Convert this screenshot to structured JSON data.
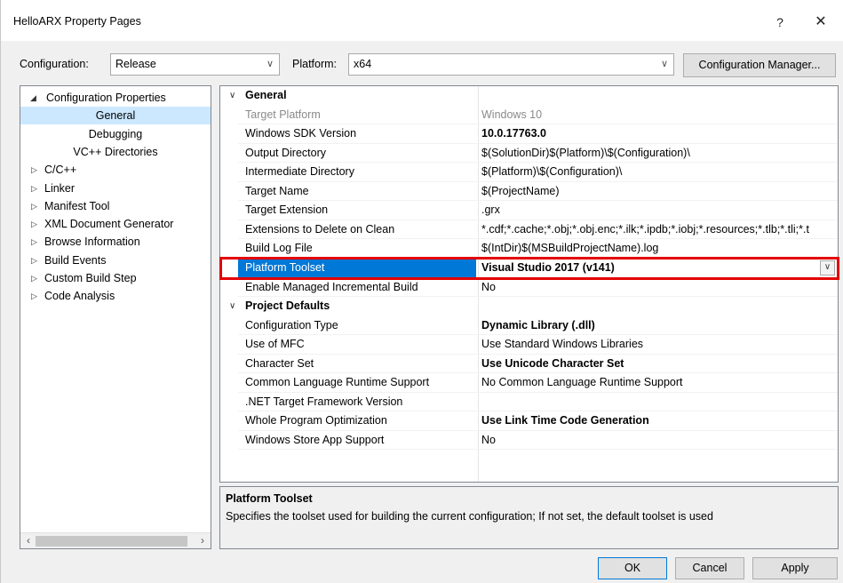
{
  "window": {
    "title": "HelloARX Property Pages",
    "help_glyph": "?",
    "close_glyph": "✕"
  },
  "toolbar": {
    "configuration_label": "Configuration:",
    "configuration_value": "Release",
    "platform_label": "Platform:",
    "platform_value": "x64",
    "config_manager_label": "Configuration Manager..."
  },
  "tree": {
    "items": [
      {
        "label": "Configuration Properties",
        "arrow": "◢",
        "level": 0
      },
      {
        "label": "General",
        "level": 1,
        "selected": true
      },
      {
        "label": "Debugging",
        "level": 1
      },
      {
        "label": "VC++ Directories",
        "level": 1
      },
      {
        "label": "C/C++",
        "arrow": "▷",
        "level": 0
      },
      {
        "label": "Linker",
        "arrow": "▷",
        "level": 0
      },
      {
        "label": "Manifest Tool",
        "arrow": "▷",
        "level": 0
      },
      {
        "label": "XML Document Generator",
        "arrow": "▷",
        "level": 0
      },
      {
        "label": "Browse Information",
        "arrow": "▷",
        "level": 0
      },
      {
        "label": "Build Events",
        "arrow": "▷",
        "level": 0
      },
      {
        "label": "Custom Build Step",
        "arrow": "▷",
        "level": 0
      },
      {
        "label": "Code Analysis",
        "arrow": "▷",
        "level": 0
      }
    ]
  },
  "grid": {
    "rows": [
      {
        "type": "cat",
        "name": "General",
        "chev": "∨"
      },
      {
        "name": "Target Platform",
        "value": "Windows 10",
        "disabled": true
      },
      {
        "name": "Windows SDK Version",
        "value": "10.0.17763.0",
        "bold": true
      },
      {
        "name": "Output Directory",
        "value": "$(SolutionDir)$(Platform)\\$(Configuration)\\"
      },
      {
        "name": "Intermediate Directory",
        "value": "$(Platform)\\$(Configuration)\\"
      },
      {
        "name": "Target Name",
        "value": "$(ProjectName)"
      },
      {
        "name": "Target Extension",
        "value": ".grx"
      },
      {
        "name": "Extensions to Delete on Clean",
        "value": "*.cdf;*.cache;*.obj;*.obj.enc;*.ilk;*.ipdb;*.iobj;*.resources;*.tlb;*.tli;*.t"
      },
      {
        "name": "Build Log File",
        "value": "$(IntDir)$(MSBuildProjectName).log"
      },
      {
        "name": "Platform Toolset",
        "value": "Visual Studio 2017 (v141)",
        "bold": true,
        "selected": true
      },
      {
        "name": "Enable Managed Incremental Build",
        "value": "No"
      },
      {
        "type": "cat",
        "name": "Project Defaults",
        "chev": "∨"
      },
      {
        "name": "Configuration Type",
        "value": "Dynamic Library (.dll)",
        "bold": true
      },
      {
        "name": "Use of MFC",
        "value": "Use Standard Windows Libraries"
      },
      {
        "name": "Character Set",
        "value": "Use Unicode Character Set",
        "bold": true
      },
      {
        "name": "Common Language Runtime Support",
        "value": "No Common Language Runtime Support"
      },
      {
        "name": ".NET Target Framework Version",
        "value": ""
      },
      {
        "name": "Whole Program Optimization",
        "value": "Use Link Time Code Generation",
        "bold": true
      },
      {
        "name": "Windows Store App Support",
        "value": "No"
      }
    ]
  },
  "description": {
    "title": "Platform Toolset",
    "text": "Specifies the toolset used for building the current configuration; If not set, the default toolset is used"
  },
  "buttons": {
    "ok": "OK",
    "cancel": "Cancel",
    "apply": "Apply"
  },
  "colors": {
    "selection": "#0078d7",
    "tree_selection": "#cce8ff",
    "highlight_box": "#e40000"
  }
}
